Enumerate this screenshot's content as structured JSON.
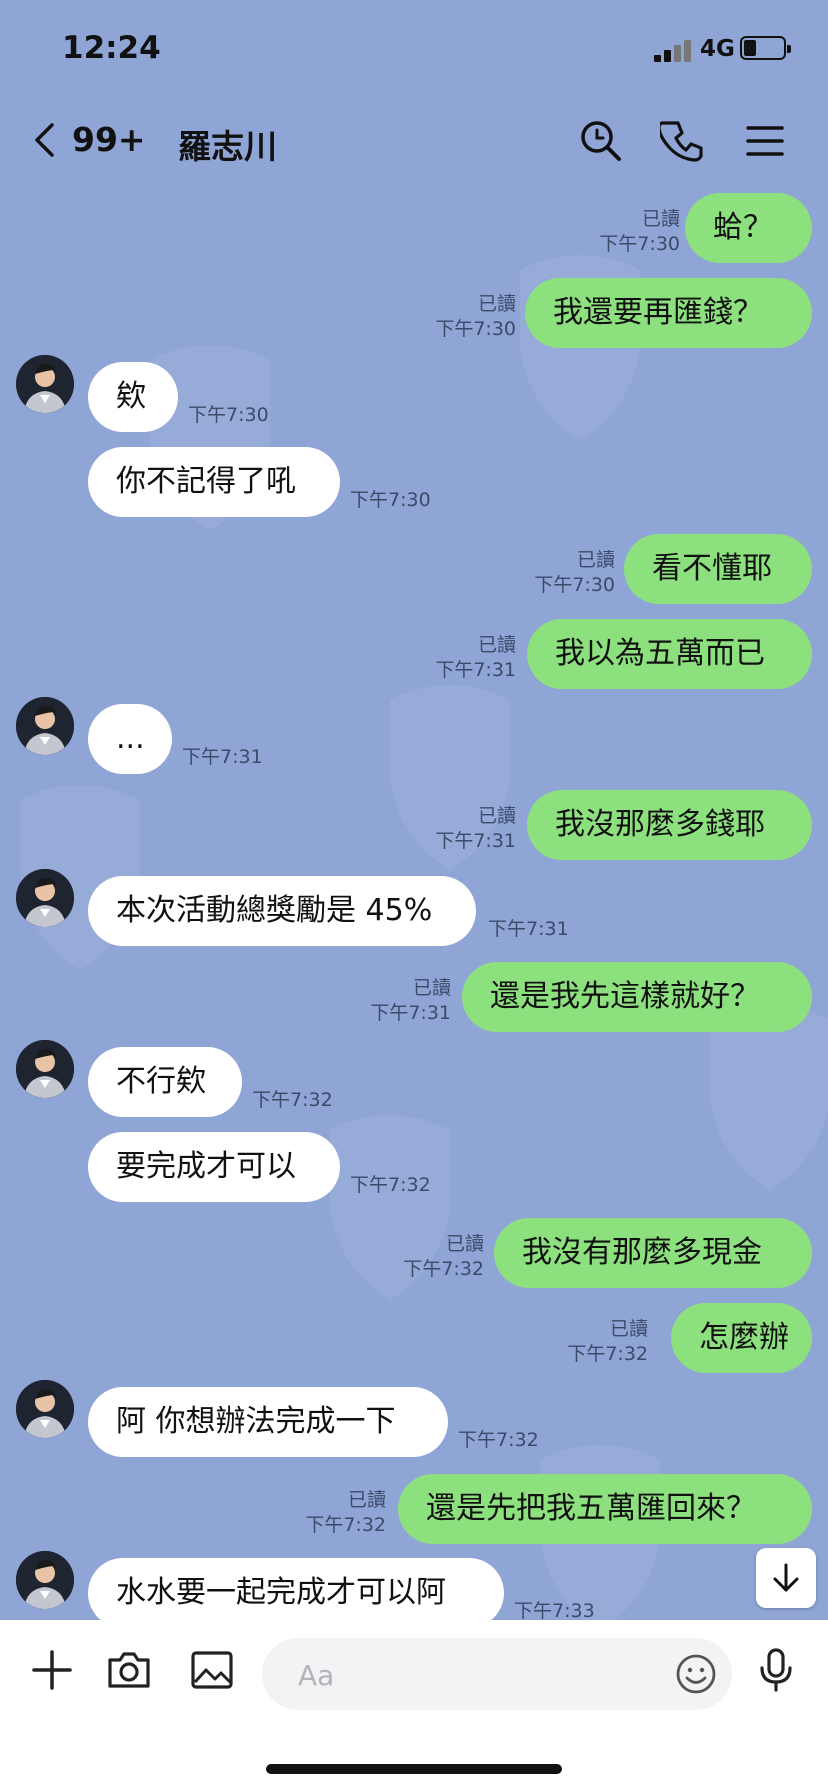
{
  "status_bar": {
    "time": "12:24",
    "network": "4G"
  },
  "header": {
    "back_count": "99+",
    "title": "羅志川"
  },
  "messages": [
    {
      "side": "out",
      "text": "蛤？",
      "read": "已讀",
      "time": "下午7:30"
    },
    {
      "side": "out",
      "text": "我還要再匯錢？",
      "read": "已讀",
      "time": "下午7:30"
    },
    {
      "side": "in",
      "text": "欸",
      "time": "下午7:30",
      "avatar": true
    },
    {
      "side": "in",
      "text": "你不記得了吼",
      "time": "下午7:30",
      "avatar": false
    },
    {
      "side": "out",
      "text": "看不懂耶",
      "read": "已讀",
      "time": "下午7:30"
    },
    {
      "side": "out",
      "text": "我以為五萬而已",
      "read": "已讀",
      "time": "下午7:31"
    },
    {
      "side": "in",
      "text": "...",
      "time": "下午7:31",
      "avatar": true
    },
    {
      "side": "out",
      "text": "我沒那麼多錢耶",
      "read": "已讀",
      "time": "下午7:31"
    },
    {
      "side": "in",
      "text": "本次活動總獎勵是 45%",
      "time": "下午7:31",
      "avatar": true
    },
    {
      "side": "out",
      "text": "還是我先這樣就好？",
      "read": "已讀",
      "time": "下午7:31"
    },
    {
      "side": "in",
      "text": "不行欸",
      "time": "下午7:32",
      "avatar": true
    },
    {
      "side": "in",
      "text": "要完成才可以",
      "time": "下午7:32",
      "avatar": false
    },
    {
      "side": "out",
      "text": "我沒有那麼多現金",
      "read": "已讀",
      "time": "下午7:32"
    },
    {
      "side": "out",
      "text": "怎麼辦",
      "read": "已讀",
      "time": "下午7:32"
    },
    {
      "side": "in",
      "text": "阿 你想辦法完成一下",
      "time": "下午7:32",
      "avatar": true
    },
    {
      "side": "out",
      "text": "還是先把我五萬匯回來？",
      "read": "已讀",
      "time": "下午7:32"
    },
    {
      "side": "in",
      "text": "水水要一起完成才可以阿",
      "time": "下午7:33",
      "avatar": true
    }
  ],
  "composer": {
    "placeholder": "Aa"
  },
  "colors": {
    "background": "#8fa5d6",
    "outgoing_bubble": "#8de07e",
    "incoming_bubble": "#ffffff"
  }
}
